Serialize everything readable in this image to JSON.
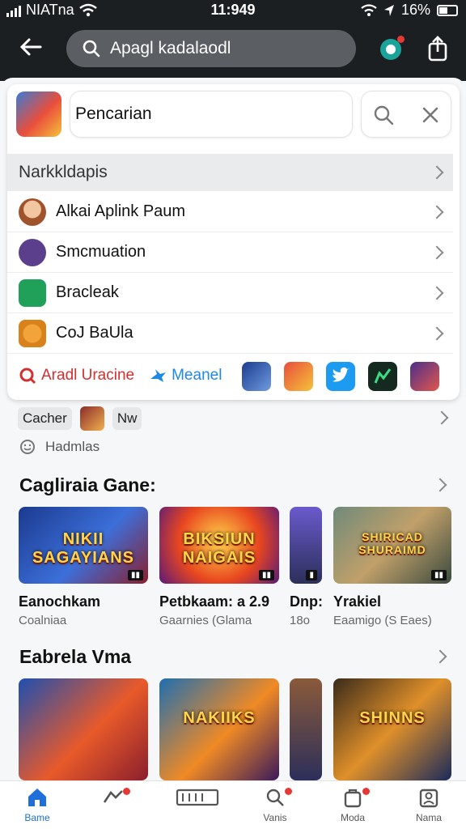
{
  "status": {
    "carrier": "NIATna",
    "time": "11:949",
    "battery": "16%"
  },
  "header": {
    "search_text": "Apagl kadalaodl"
  },
  "query": {
    "text": "Pencarian"
  },
  "suggestions": {
    "title": "Narkkldapis",
    "items": [
      {
        "label": "Alkai Aplink Paum"
      },
      {
        "label": "Smcmuation"
      },
      {
        "label": "Bracleak"
      },
      {
        "label": "CoJ BaUla"
      }
    ],
    "share_primary": "Aradl Uracine",
    "share_secondary": "Meanel"
  },
  "chips": {
    "first": "Cacher",
    "second": "Nw"
  },
  "history": {
    "label": "Hadmlas"
  },
  "section_games": {
    "title": "Cagliraia Gane:",
    "tiles": [
      {
        "art": "NIKII SAGAYIANS",
        "name": "Eanochkam",
        "sub": "Coalniaa"
      },
      {
        "art": "BIKSIUN NAIGAIS",
        "name": "Petbkaam: a 2.9",
        "sub": "Gaarnies (Glama"
      },
      {
        "art": "",
        "name": "Dnp:",
        "sub": "18o"
      },
      {
        "art": "SHIRICAD SHURAIMD",
        "name": "Yrakiel",
        "sub": "Eaamigo (S Eaes)"
      }
    ]
  },
  "section_videos": {
    "title": "Eabrela Vma",
    "tiles": [
      {
        "art": ""
      },
      {
        "art": "NAKIIKS"
      },
      {
        "art": ""
      },
      {
        "art": "SHINNS"
      }
    ]
  },
  "nav": [
    {
      "label": "Bame"
    },
    {
      "label": ""
    },
    {
      "label": ""
    },
    {
      "label": "Vanis"
    },
    {
      "label": "Moda"
    },
    {
      "label": "Nama"
    }
  ],
  "colors": {
    "accent": "#1e6fd9",
    "header_bg": "#1c1f22",
    "alert": "#e53935"
  }
}
